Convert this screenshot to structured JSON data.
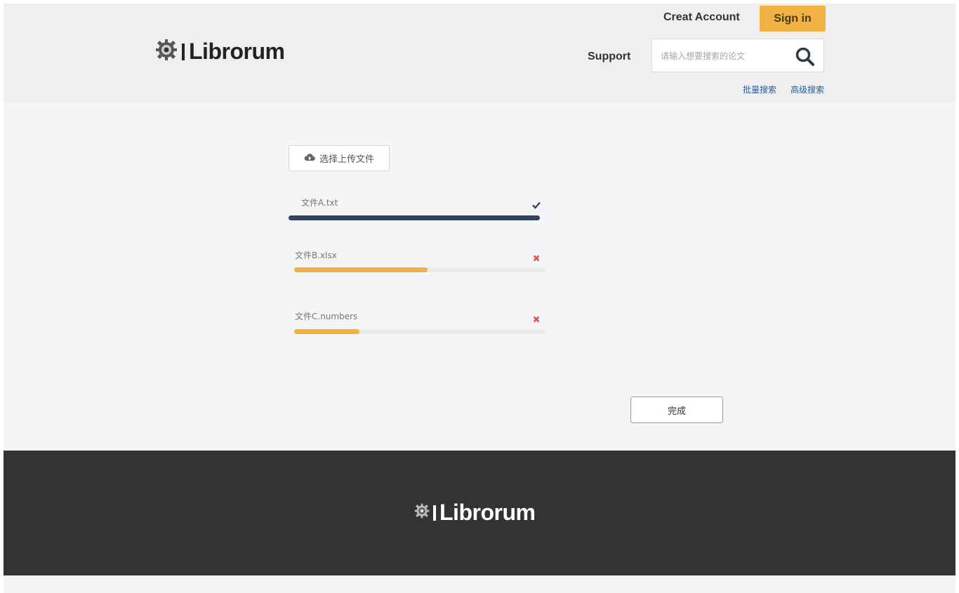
{
  "header": {
    "brand": "Librorum",
    "create_account": "Creat Account",
    "sign_in": "Sign in",
    "support": "Support",
    "search_placeholder": "请输入想要搜索的论文",
    "links": {
      "batch_search": "批量搜索",
      "advanced_search": "高级搜索"
    }
  },
  "upload": {
    "choose_label": "选择上传文件",
    "files": [
      {
        "name": "文件A.txt",
        "progress": 1.0,
        "status": "done"
      },
      {
        "name": "文件B.xlsx",
        "progress": 0.53,
        "status": "uploading"
      },
      {
        "name": "文件C.numbers",
        "progress": 0.26,
        "status": "uploading"
      }
    ],
    "done_label": "完成"
  },
  "footer": {
    "brand": "Librorum"
  },
  "colors": {
    "accent": "#f2b143",
    "progress_done": "#33445c",
    "progress_active": "#f2b143",
    "remove": "#e05050",
    "footer_bg": "#333333"
  },
  "icons": {
    "logo": "gear-lightbulb-icon",
    "search": "search-icon",
    "upload": "cloud-upload-icon",
    "done": "check-icon",
    "remove": "close-icon"
  }
}
